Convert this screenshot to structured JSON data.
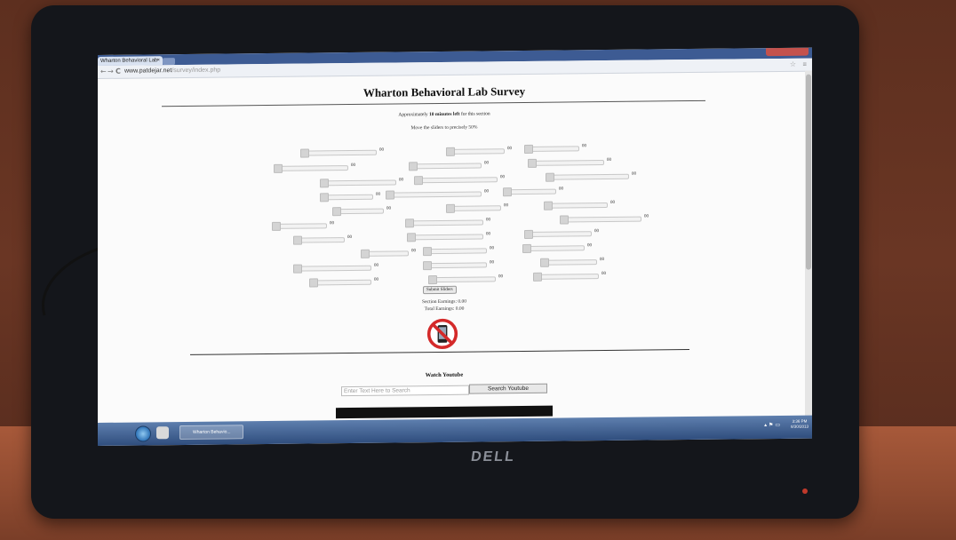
{
  "browser": {
    "tab_title": "Wharton Behavioral Lab",
    "tab_close": "×",
    "back": "←",
    "forward": "→",
    "reload": "C",
    "url_host": "www.patdejar.net",
    "url_path": "/survey/index.php",
    "star": "☆",
    "menu": "≡"
  },
  "survey": {
    "title": "Wharton Behavioral Lab Survey",
    "time_prefix": "Approximately ",
    "time_bold": "10 minutes left",
    "time_suffix": " for this section",
    "instruction": "Move the sliders to precisely 50%",
    "sliders": [
      {
        "value": "00"
      },
      {
        "value": "00"
      },
      {
        "value": "00"
      },
      {
        "value": "00"
      },
      {
        "value": "00"
      },
      {
        "value": "00"
      },
      {
        "value": "00"
      },
      {
        "value": "00"
      },
      {
        "value": "00"
      },
      {
        "value": "00"
      },
      {
        "value": "00"
      },
      {
        "value": "00"
      },
      {
        "value": "00"
      },
      {
        "value": "00"
      },
      {
        "value": "00"
      },
      {
        "value": "00"
      },
      {
        "value": "00"
      },
      {
        "value": "00"
      },
      {
        "value": "00"
      },
      {
        "value": "00"
      },
      {
        "value": "00"
      },
      {
        "value": "00"
      },
      {
        "value": "00"
      },
      {
        "value": "00"
      },
      {
        "value": "00"
      },
      {
        "value": "00"
      },
      {
        "value": "00"
      },
      {
        "value": "00"
      },
      {
        "value": "00"
      },
      {
        "value": "00"
      }
    ],
    "submit_label": "Submit Sliders",
    "section_earnings": "Section Earnings: 0.00",
    "total_earnings": "Total Earnings: 0.00"
  },
  "youtube": {
    "heading": "Watch Youtube",
    "placeholder": "Enter Text Here to Search",
    "button": "Search Youtube"
  },
  "taskbar": {
    "app_label": "Wharton Behavio...",
    "tray": "▴ ⚑ ▭",
    "time": "3:36 PM",
    "date": "8/30/2013"
  },
  "monitor": {
    "brand": "DELL"
  },
  "colors": {
    "accent_red": "#d42a2a",
    "taskbar": "#2f4d7d"
  }
}
